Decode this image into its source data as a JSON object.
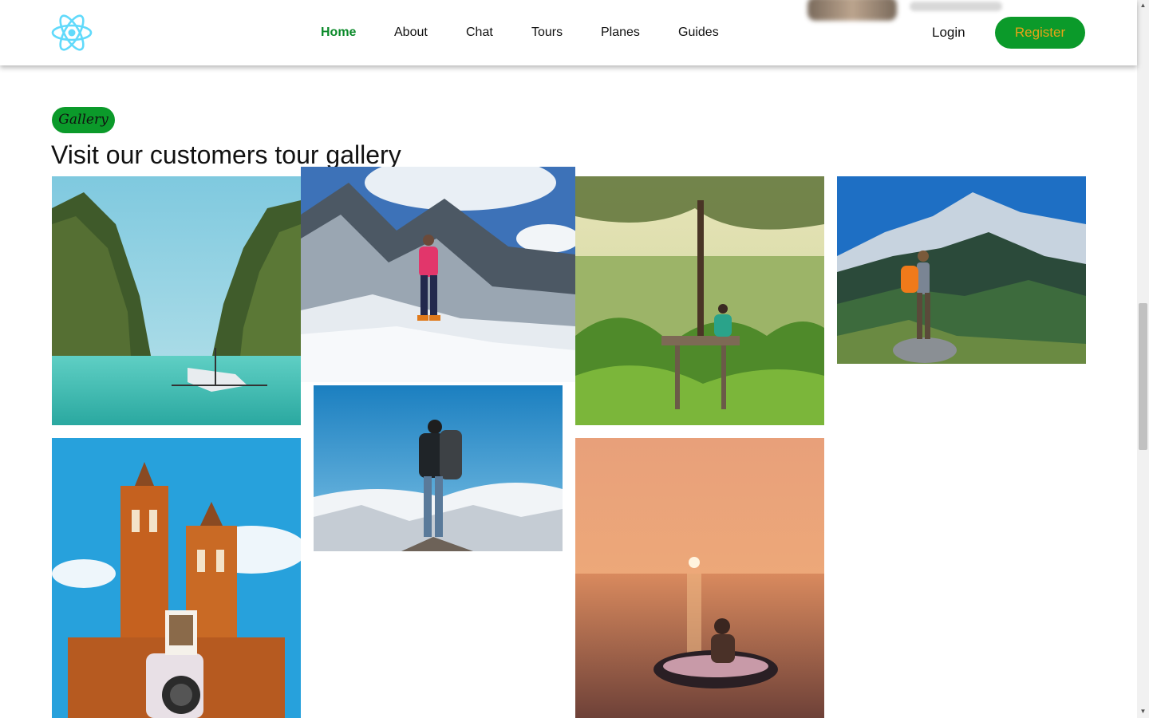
{
  "header": {
    "logo_icon": "react-atom-icon",
    "nav": [
      {
        "label": "Home",
        "active": true
      },
      {
        "label": "About",
        "active": false
      },
      {
        "label": "Chat",
        "active": false
      },
      {
        "label": "Tours",
        "active": false
      },
      {
        "label": "Planes",
        "active": false
      },
      {
        "label": "Guides",
        "active": false
      }
    ],
    "login_label": "Login",
    "register_label": "Register"
  },
  "gallery": {
    "badge": "Gallery",
    "heading": "Visit our customers tour gallery",
    "photos": [
      {
        "subject": "tropical lagoon with cliffs and boat"
      },
      {
        "subject": "climber in pink jacket on snowy mountain"
      },
      {
        "subject": "person sitting on tree platform over valley"
      },
      {
        "subject": "hiker with orange backpack on mountain ridge"
      },
      {
        "subject": "gothic brick church with instant camera"
      },
      {
        "subject": "backpacker above clouds on summit"
      },
      {
        "subject": "person floating on ring in sea at sunset"
      }
    ]
  },
  "colors": {
    "brand_green": "#0b9a2a",
    "active_nav": "#0b8a2a",
    "register_text": "#e8a317",
    "logo": "#61dafb"
  }
}
